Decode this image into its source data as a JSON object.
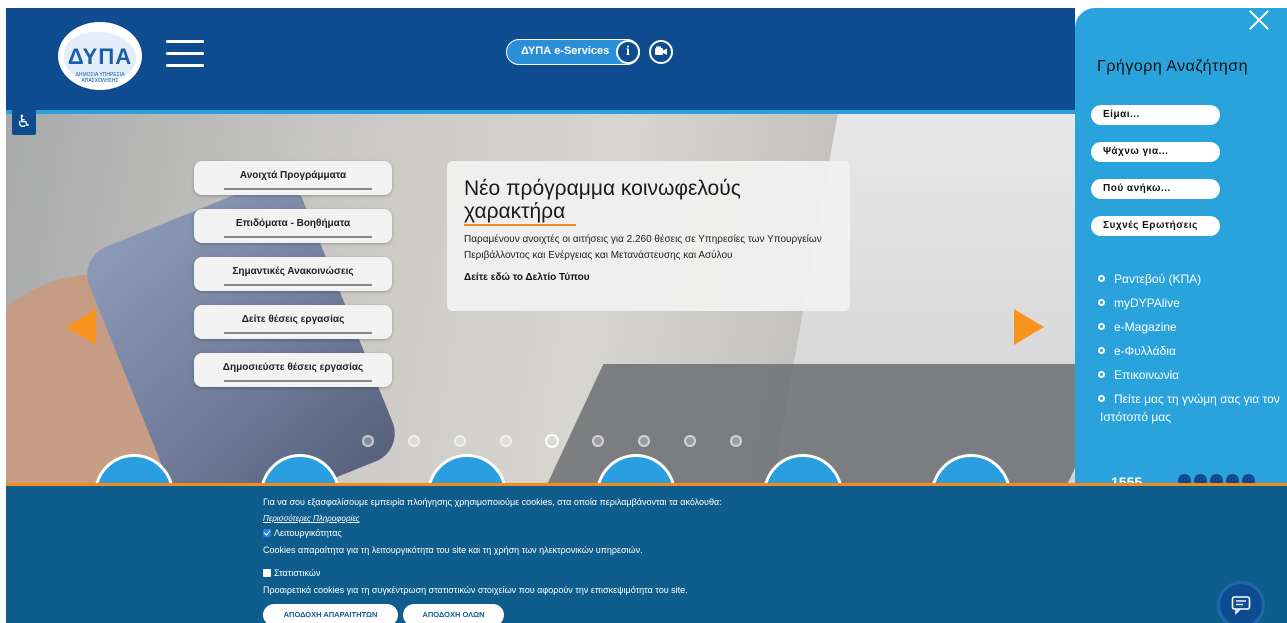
{
  "header": {
    "logo_text": "ΔΥΠΑ",
    "logo_subtext": "ΔΗΜΟΣΙΑ ΥΠΗΡΕΣΙΑ ΑΠΑΣΧΟΛΗΣΗΣ",
    "eservices_label": "ΔΥΠΑ e-Services",
    "info_glyph": "i"
  },
  "hero": {
    "menu_buttons": [
      "Ανοιχτά Προγράμματα",
      "Επιδόματα - Βοηθήματα",
      "Σημαντικές Ανακοινώσεις",
      "Δείτε θέσεις εργασίας",
      "Δημοσιεύστε θέσεις εργασίας"
    ],
    "slide": {
      "title": "Νέο πρόγραμμα κοινωφελούς χαρακτήρα",
      "body": "Παραμένουν ανοιχτές οι αιτήσεις για 2.260 θέσεις σε Υπηρεσίες των Υπουργείων Περιβάλλοντος και Ενέργειας και Μετανάστευσης και Ασύλου",
      "link": "Δείτε εδώ το Δελτίο Τύπου"
    },
    "active_slide": 4,
    "slide_count": 9
  },
  "quick_search": {
    "title": "Γρήγορη Αναζήτηση",
    "buttons": [
      "Είμαι...",
      "Ψάχνω για...",
      "Πού ανήκω...",
      "Συχνές Ερωτήσεις"
    ],
    "links": [
      "Ραντεβού (ΚΠΑ)",
      "myDYPAlive",
      "e-Magazine",
      "e-Φυλλάδια",
      "Επικοινωνία",
      "Πείτε μας τη γνώμη σας για τον Ιστότοπό μας"
    ],
    "phone": "1555"
  },
  "cookie": {
    "intro": "Για να σου εξασφαλίσουμε εμπειρία πλοήγησης χρησιμοποιούμε cookies, στα οποία περιλαμβάνονται τα ακόλουθα:",
    "more_info": "Περισσότερες Πληροφορίες",
    "functional_label": "Λειτουργικότητας",
    "functional_desc": "Cookies απαραίτητα για τη λειτουργικότητα του site και τη χρήση των ηλεκτρονικών υπηρεσιών.",
    "stats_label": "Στατιστικών",
    "stats_desc": "Προαιρετικά cookies για τη συγκέντρωση στατιστικών στοιχείων που αφορούν την επισκεψιμότητα του site.",
    "accept_necessary": "ΑΠΟΔΟΧΗ ΑΠΑΡΑΙΤΗΤΩΝ",
    "accept_all": "ΑΠΟΔΟΧΗ ΟΛΩΝ"
  },
  "colors": {
    "header_blue": "#0f4b8f",
    "sidebar_blue": "#2aa3dd",
    "cookie_blue": "#0f5d8c",
    "accent_orange": "#f7941d"
  }
}
